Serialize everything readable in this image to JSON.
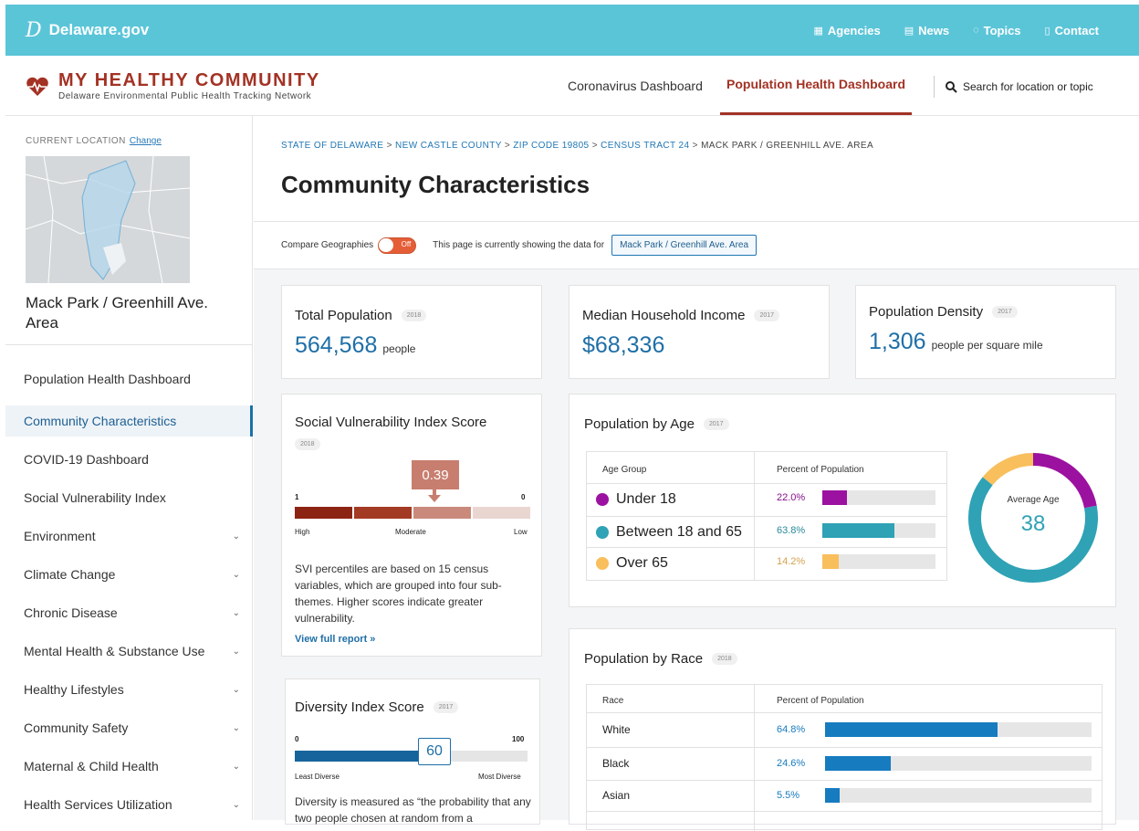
{
  "site": {
    "logo_letter": "D",
    "name": "Delaware.gov",
    "nav": [
      {
        "icon": "building-icon",
        "label": "Agencies"
      },
      {
        "icon": "newspaper-icon",
        "label": "News"
      },
      {
        "icon": "chat-icon",
        "label": "Topics"
      },
      {
        "icon": "phone-icon",
        "label": "Contact"
      }
    ]
  },
  "brand": {
    "title": "MY HEALTHY COMMUNITY",
    "subtitle": "Delaware Environmental Public Health Tracking Network"
  },
  "header_nav": {
    "coronavirus": "Coronavirus Dashboard",
    "population": "Population Health Dashboard",
    "search": "Search for location or topic"
  },
  "sidebar": {
    "current_location_label": "CURRENT LOCATION",
    "change_link": "Change",
    "location_name": "Mack Park / Greenhill Ave. Area",
    "items": [
      {
        "label": "Population Health Dashboard",
        "expandable": false,
        "active": false
      },
      {
        "label": "Community Characteristics",
        "expandable": false,
        "active": true
      },
      {
        "label": "COVID-19 Dashboard",
        "expandable": false,
        "active": false
      },
      {
        "label": "Social Vulnerability Index",
        "expandable": false,
        "active": false
      },
      {
        "label": "Environment",
        "expandable": true,
        "active": false
      },
      {
        "label": "Climate Change",
        "expandable": true,
        "active": false
      },
      {
        "label": "Chronic Disease",
        "expandable": true,
        "active": false
      },
      {
        "label": "Mental Health & Substance Use",
        "expandable": true,
        "active": false
      },
      {
        "label": "Healthy Lifestyles",
        "expandable": true,
        "active": false
      },
      {
        "label": "Community Safety",
        "expandable": true,
        "active": false
      },
      {
        "label": "Maternal & Child Health",
        "expandable": true,
        "active": false
      },
      {
        "label": "Health Services Utilization",
        "expandable": true,
        "active": false
      }
    ]
  },
  "breadcrumb": {
    "links": [
      "STATE OF DELAWARE",
      "NEW CASTLE COUNTY",
      "ZIP CODE 19805",
      "CENSUS TRACT 24"
    ],
    "current": "MACK PARK / GREENHILL AVE. AREA",
    "separator": ">"
  },
  "page_title": "Community Characteristics",
  "compare": {
    "label": "Compare Geographies",
    "toggle_state": "Off",
    "showing_text": "This page is currently showing the data for",
    "location_button": "Mack Park / Greenhill Ave. Area"
  },
  "stats": {
    "total_population": {
      "title": "Total Population",
      "year": "2018",
      "value": "564,568",
      "unit": "people"
    },
    "median_income": {
      "title": "Median Household Income",
      "year": "2017",
      "value": "$68,336",
      "unit": ""
    },
    "density": {
      "title": "Population Density",
      "year": "2017",
      "value": "1,306",
      "unit": "people per square mile"
    }
  },
  "svi": {
    "title": "Social Vulnerability Index Score",
    "year": "2018",
    "score": "0.39",
    "score_value": 0.39,
    "left_num": "1",
    "right_num": "0",
    "labels": [
      "High",
      "Moderate",
      "Low"
    ],
    "segment_colors": [
      "#8c2414",
      "#a33a24",
      "#c98a7c",
      "#ead6d1"
    ],
    "description": "SVI percentiles are based on 15 census variables, which are grouped into four sub-themes. Higher scores indicate greater vulnerability.",
    "link": "View full report »"
  },
  "diversity": {
    "title": "Diversity Index Score",
    "year": "2017",
    "score": "60",
    "score_value": 60,
    "min": "0",
    "max": "100",
    "min_label": "Least Diverse",
    "max_label": "Most Diverse",
    "description": "Diversity is measured as “the probability that any two people chosen at random from a"
  },
  "age": {
    "title": "Population by Age",
    "year": "2017",
    "headers": [
      "Age Group",
      "Percent of Population"
    ],
    "rows": [
      {
        "label": "Under 18",
        "pct": "22.0%",
        "value": 22.0,
        "color": "#9c12a0"
      },
      {
        "label": "Between 18 and 65",
        "pct": "63.8%",
        "value": 63.8,
        "color": "#2fa2b5"
      },
      {
        "label": "Over 65",
        "pct": "14.2%",
        "value": 14.2,
        "color": "#f8bf5c"
      }
    ],
    "donut_label": "Average Age",
    "donut_value": "38"
  },
  "race": {
    "title": "Population by Race",
    "year": "2018",
    "headers": [
      "Race",
      "Percent of Population"
    ],
    "rows": [
      {
        "label": "White",
        "pct": "64.8%",
        "value": 64.8
      },
      {
        "label": "Black",
        "pct": "24.6%",
        "value": 24.6
      },
      {
        "label": "Asian",
        "pct": "5.5%",
        "value": 5.5
      }
    ],
    "bar_color": "#167bbf"
  },
  "colors": {
    "accent_blue": "#1f6fa7",
    "brand_red": "#a33224",
    "topbar": "#5bc5d8"
  }
}
